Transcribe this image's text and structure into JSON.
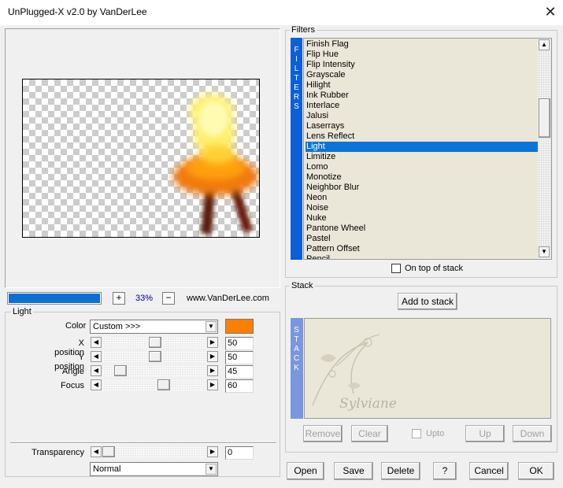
{
  "window": {
    "title": "UnPlugged-X v2.0 by VanDerLee",
    "close_glyph": "✕"
  },
  "preview": {
    "zoom_text": "33%",
    "website": "www.VanDerLee.com",
    "minus_label": "−",
    "plus_label": "+",
    "progress_fraction": 1.0
  },
  "filters_panel": {
    "title": "Filters",
    "vertical_tab_text": "FILTERS",
    "items": [
      "Finish Flag",
      "Flip Hue",
      "Flip Intensity",
      "Grayscale",
      "Hilight",
      "Ink Rubber",
      "Interlace",
      "Jalusi",
      "Laserrays",
      "Lens Reflect",
      "Light",
      "Limitize",
      "Lomo",
      "Monotize",
      "Neighbor Blur",
      "Neon",
      "Noise",
      "Nuke",
      "Pantone Wheel",
      "Pastel",
      "Pattern Offset",
      "Pencil"
    ],
    "selected": "Light",
    "on_top_label": "On top of stack",
    "on_top_checked": false
  },
  "stack_panel": {
    "title": "Stack",
    "add_label": "Add to stack",
    "vertical_tab_text": "STACK",
    "watermark": "Sylviane",
    "remove_label": "Remove",
    "clear_label": "Clear",
    "upto_label": "Upto",
    "up_label": "Up",
    "down_label": "Down"
  },
  "light_panel": {
    "title": "Light",
    "color_label": "Color",
    "color_value": "Custom >>>",
    "color_swatch": "#ff8000",
    "sliders": [
      {
        "label": "X position",
        "value": "50",
        "fraction": 0.5
      },
      {
        "label": "Y position",
        "value": "50",
        "fraction": 0.5
      },
      {
        "label": "Angle",
        "value": "45",
        "fraction": 0.125
      },
      {
        "label": "Focus",
        "value": "60",
        "fraction": 0.6
      }
    ],
    "transparency_label": "Transparency",
    "transparency_value": "0",
    "transparency_fraction": 0.0,
    "blend_mode": "Normal"
  },
  "footer": {
    "open_label": "Open",
    "save_label": "Save",
    "delete_label": "Delete",
    "help_label": "?",
    "cancel_label": "Cancel",
    "ok_label": "OK"
  },
  "colors": {
    "selection": "#0a74da",
    "filters_tab": "#0b5fd8",
    "stack_tab": "#7a96de",
    "list_bg": "#ebe7d8",
    "progress": "#0b6fd6"
  }
}
